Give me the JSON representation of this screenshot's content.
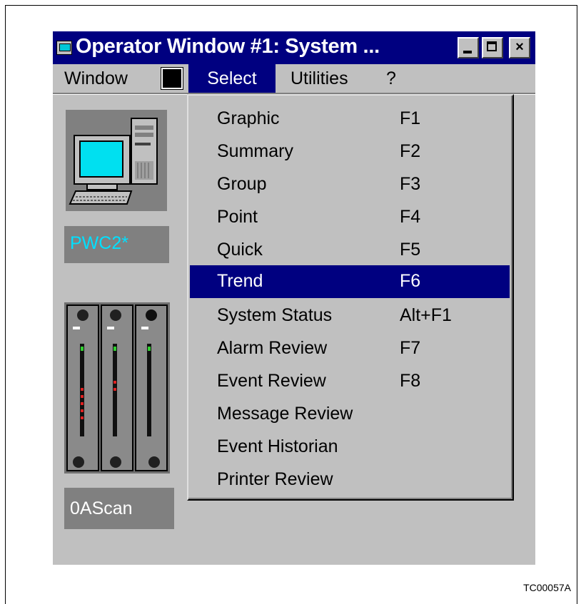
{
  "window": {
    "title": "Operator Window #1: System ...",
    "controls": {
      "minimize": "",
      "maximize": "",
      "close": "×"
    }
  },
  "menubar": {
    "items": [
      "Window",
      "Select",
      "Utilities",
      "?"
    ],
    "active": "Select"
  },
  "sidebar": {
    "node_label": "PWC2*",
    "scan_label": "0AScan"
  },
  "dropdown": {
    "items": [
      {
        "label": "Graphic",
        "shortcut": "F1"
      },
      {
        "label": "Summary",
        "shortcut": "F2"
      },
      {
        "label": "Group",
        "shortcut": "F3"
      },
      {
        "label": "Point",
        "shortcut": "F4"
      },
      {
        "label": "Quick",
        "shortcut": "F5"
      },
      {
        "label": "Trend",
        "shortcut": "F6",
        "highlighted": true
      },
      {
        "label": "System Status",
        "shortcut": "Alt+F1"
      },
      {
        "label": "Alarm Review",
        "shortcut": "F7"
      },
      {
        "label": "Event Review",
        "shortcut": "F8"
      },
      {
        "label": "Message Review",
        "shortcut": ""
      },
      {
        "label": "Event Historian",
        "shortcut": ""
      },
      {
        "label": "Printer Review",
        "shortcut": ""
      }
    ]
  },
  "figure_id": "TC00057A",
  "colors": {
    "titlebar": "#000080",
    "face": "#c0c0c0",
    "highlight": "#000080",
    "node_text": "#00e0ff"
  }
}
